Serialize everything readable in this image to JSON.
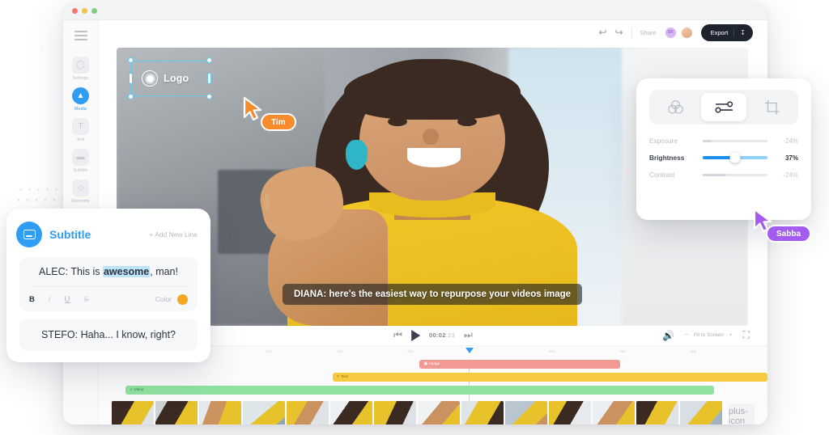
{
  "window": {
    "traffic_lights": [
      "close",
      "minimize",
      "maximize"
    ]
  },
  "sidebar": {
    "menu_icon": "hamburger-icon",
    "items": [
      {
        "label": "Settings",
        "icon": "gear-icon",
        "active": false
      },
      {
        "label": "Media",
        "icon": "media-icon",
        "active": true
      },
      {
        "label": "Text",
        "icon": "text-icon",
        "active": false
      },
      {
        "label": "Subtitle",
        "icon": "subtitle-icon",
        "active": false
      },
      {
        "label": "Elements",
        "icon": "elements-icon",
        "active": false
      }
    ],
    "pen_icon": "pen-icon"
  },
  "topbar": {
    "undo_icon": "undo-icon",
    "redo_icon": "redo-icon",
    "share_label": "Share",
    "avatars": [
      {
        "name": "avatar-initials",
        "initials": "SK"
      },
      {
        "name": "avatar-photo",
        "initials": ""
      }
    ],
    "export_label": "Export",
    "export_download_icon": "download-icon"
  },
  "canvas": {
    "logo_element": {
      "label": "Logo",
      "icon": "logo-ring-icon",
      "selected": true,
      "selection_color": "#5ccaf0"
    },
    "subtitle_overlay": {
      "speaker": "DIANA:",
      "text": "here's the easiest way to repurpose your videos image"
    },
    "cursors": [
      {
        "name": "Tim",
        "color": "#f68b2c"
      },
      {
        "name": "Sabba",
        "color": "#a45cf0"
      }
    ]
  },
  "transport": {
    "prev_icon": "skip-previous-icon",
    "play_icon": "play-icon",
    "next_icon": "skip-next-icon",
    "timecode_main": "00:02",
    "timecode_frames": ":23",
    "volume_icon": "volume-icon",
    "zoom_out": "−",
    "zoom_label": "Fit to Screen",
    "zoom_in": "+",
    "fullscreen_icon": "fullscreen-icon"
  },
  "timeline": {
    "ruler_ticks": [
      "0s",
      "5s",
      "10s",
      "15s",
      "20s",
      "25s",
      "30s",
      "35s",
      "40s"
    ],
    "playhead_position_pct": 55,
    "tracks": [
      {
        "label": "Image",
        "icon": "image-icon",
        "color": "#f09a93",
        "start_pct": 48,
        "width_pct": 30,
        "lane": 0
      },
      {
        "label": "Text",
        "icon": "text-icon",
        "color": "#f7cb3f",
        "start_pct": 35,
        "width_pct": 65,
        "lane": 1
      },
      {
        "label": "Voice",
        "icon": "voice-icon",
        "color": "#8fe2a0",
        "start_pct": 4,
        "width_pct": 88,
        "lane": 2
      }
    ],
    "clip_count": 14,
    "add_clip_icon": "plus-icon"
  },
  "adjust_panel": {
    "tabs": [
      {
        "name": "filters-tab",
        "icon": "color-wheel-icon",
        "active": false
      },
      {
        "name": "adjust-tab",
        "icon": "sliders-icon",
        "active": true
      },
      {
        "name": "crop-tab",
        "icon": "crop-icon",
        "active": false
      }
    ],
    "sliders": [
      {
        "label": "Exposure",
        "value": "-24%",
        "fill_pct": 14,
        "active": false
      },
      {
        "label": "Brightness",
        "value": "37%",
        "fill_pct": 50,
        "active": true
      },
      {
        "label": "Contrast",
        "value": "-24%",
        "fill_pct": 36,
        "active": false
      }
    ],
    "accent_color": "#1a90f0"
  },
  "subtitle_panel": {
    "icon": "subtitle-icon",
    "title": "Subtitle",
    "add_new_line": "+ Add New Line",
    "line1": {
      "prefix": "ALEC: This is ",
      "highlight": "awesome",
      "suffix": ", man!"
    },
    "format": {
      "bold": "B",
      "italic": "I",
      "underline": "U",
      "strike": "S",
      "color_label": "Color",
      "color_value": "#f5a623"
    },
    "line2": "STEFO: Haha... I know, right?"
  }
}
